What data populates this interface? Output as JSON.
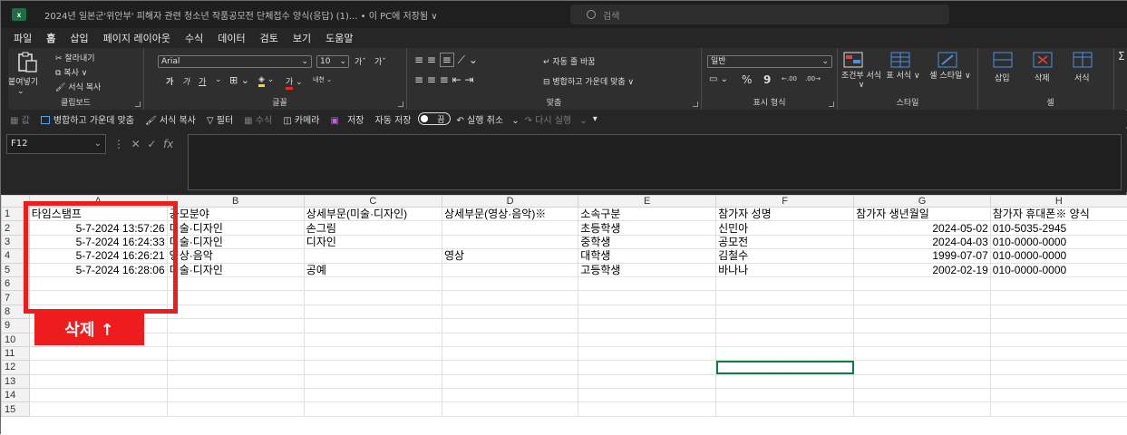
{
  "titlebar": {
    "app_icon_text": "x",
    "doc_title": "2024년 일본군'위안부' 피해자 관련 청소년 작품공모전 단체접수 양식(응답) (1)... • 이 PC에 저장됨 ∨",
    "search_placeholder": "검색"
  },
  "menu": [
    "파일",
    "홈",
    "삽입",
    "페이지 레이아웃",
    "수식",
    "데이터",
    "검토",
    "보기",
    "도움말"
  ],
  "menu_active": "홈",
  "ribbon": {
    "clipboard": {
      "paste": "붙여넣기",
      "cut": "잘라내기",
      "copy": "복사 ∨",
      "format_painter": "서식 복사",
      "label": "클립보드"
    },
    "font": {
      "name": "Arial",
      "size": "10",
      "grow": "가ˆ",
      "shrink": "가ˇ",
      "bold": "가",
      "italic": "가",
      "underline": "가",
      "label": "글꼴"
    },
    "alignment": {
      "wrap": "자동 줄 바꿈",
      "merge": "병합하고 가운데 맞춤 ∨",
      "label": "맞춤"
    },
    "number": {
      "format": "일반",
      "percent": "%",
      "comma": "9",
      "dec_up": "←.00",
      "dec_down": ".00→",
      "label": "표시 형식"
    },
    "styles": {
      "conditional": "조건부 서식 ∨",
      "table": "표 서식 ∨",
      "cell": "셀 스타일 ∨",
      "label": "스타일"
    },
    "cells": {
      "insert": "삽입",
      "delete": "삭제",
      "format": "서식",
      "label": "셀"
    }
  },
  "qat": {
    "values": "값",
    "merge": "병합하고 가운데 맞춤",
    "format_painter": "서식 복사",
    "filter": "필터",
    "formula": "수식",
    "camera": "카메라",
    "save": "저장",
    "autosave": "자동 저장",
    "autosave_state": "끔",
    "undo": "실행 취소",
    "redo": "다시 실행"
  },
  "formula_bar": {
    "name_box": "F12",
    "fx": "fx",
    "value": ""
  },
  "sheet": {
    "columns": [
      "A",
      "B",
      "C",
      "D",
      "E",
      "F",
      "G",
      "H"
    ],
    "rows": [
      [
        "타임스탬프",
        "공모분야",
        "상세부문(미술·디자인)",
        "상세부문(영상·음악)※",
        "소속구분",
        "참가자 성명",
        "참가자 생년월일",
        "참가자 휴대폰※ 양식"
      ],
      [
        "5-7-2024 13:57:26",
        "미술·디자인",
        "손그림",
        "",
        "초등학생",
        "신민아",
        "2024-05-02",
        "010-5035-2945"
      ],
      [
        "5-7-2024 16:24:33",
        "미술·디자인",
        "디자인",
        "",
        "중학생",
        "공모전",
        "2024-04-03",
        "010-0000-0000"
      ],
      [
        "5-7-2024 16:26:21",
        "영상·음악",
        "",
        "영상",
        "대학생",
        "김철수",
        "1999-07-07",
        "010-0000-0000"
      ],
      [
        "5-7-2024 16:28:06",
        "미술·디자인",
        "공예",
        "",
        "고등학생",
        "바나나",
        "2002-02-19",
        "010-0000-0000"
      ],
      [
        "",
        "",
        "",
        "",
        "",
        "",
        "",
        ""
      ],
      [
        "",
        "",
        "",
        "",
        "",
        "",
        "",
        ""
      ],
      [
        "",
        "",
        "",
        "",
        "",
        "",
        "",
        ""
      ],
      [
        "",
        "",
        "",
        "",
        "",
        "",
        "",
        ""
      ],
      [
        "",
        "",
        "",
        "",
        "",
        "",
        "",
        ""
      ],
      [
        "",
        "",
        "",
        "",
        "",
        "",
        "",
        ""
      ],
      [
        "",
        "",
        "",
        "",
        "",
        "",
        "",
        ""
      ],
      [
        "",
        "",
        "",
        "",
        "",
        "",
        "",
        ""
      ],
      [
        "",
        "",
        "",
        "",
        "",
        "",
        "",
        ""
      ],
      [
        "",
        "",
        "",
        "",
        "",
        "",
        "",
        ""
      ]
    ]
  },
  "annotation": {
    "label": "삭제 ↑",
    "color": "#ee1c1c"
  },
  "colors": {
    "accent": "#107c41",
    "excel_green": "#1d6f42",
    "underline_active": "#5eb585"
  }
}
